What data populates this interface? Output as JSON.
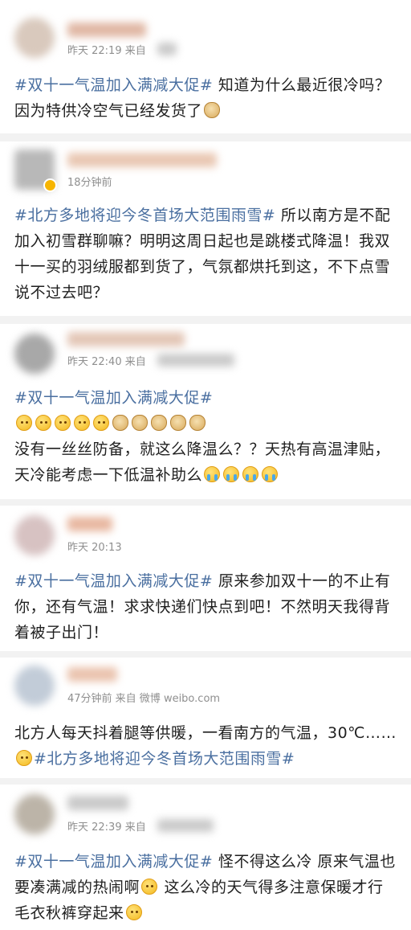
{
  "posts": [
    {
      "time": "昨天 22:19 来自",
      "prefix": "",
      "tag": "#双十一气温加入满减大促#",
      "body": " 知道为什么最近很冷吗？因为特供冷空气已经发货了",
      "emoji": "doge-icon"
    },
    {
      "time": "18分钟前",
      "tag": "#北方多地将迎今冬首场大范围雨雪#",
      "body": " 所以南方是不配加入初雪群聊嘛？明明这周日起也是跳楼式降温！我双十一买的羽绒服都到货了，气氛都烘托到这，不下点雪说不过去吧？"
    },
    {
      "time": "昨天 22:40 来自",
      "tag": "#双十一气温加入满减大促#",
      "body": "没有一丝丝防备，就这么降温么？？天热有高温津贴，天冷能考虑一下低温补助么"
    },
    {
      "time": "昨天 20:13",
      "tag": "#双十一气温加入满减大促#",
      "body": " 原来参加双十一的不止有你，还有气温！求求快递们快点到吧！不然明天我得背着被子出门！"
    },
    {
      "time": "47分钟前 来自 微博 weibo.com",
      "body_pre": "北方人每天抖着腿等供暖，一看南方的气温，30℃……",
      "tag": "#北方多地将迎今冬首场大范围雨雪#"
    },
    {
      "time": "昨天 22:39 来自",
      "tag": "#双十一气温加入满减大促#",
      "body_a": " 怪不得这么冷 原来气温也要凑满减的热闹啊",
      "body_b": " 这么冷的天气得多注意保暖才行 毛衣秋裤穿起来"
    }
  ],
  "colors": {
    "tag": "#4a6fa0",
    "text": "#1f1f1f",
    "meta": "#8f8f8f",
    "divider": "#f2f2f2"
  }
}
